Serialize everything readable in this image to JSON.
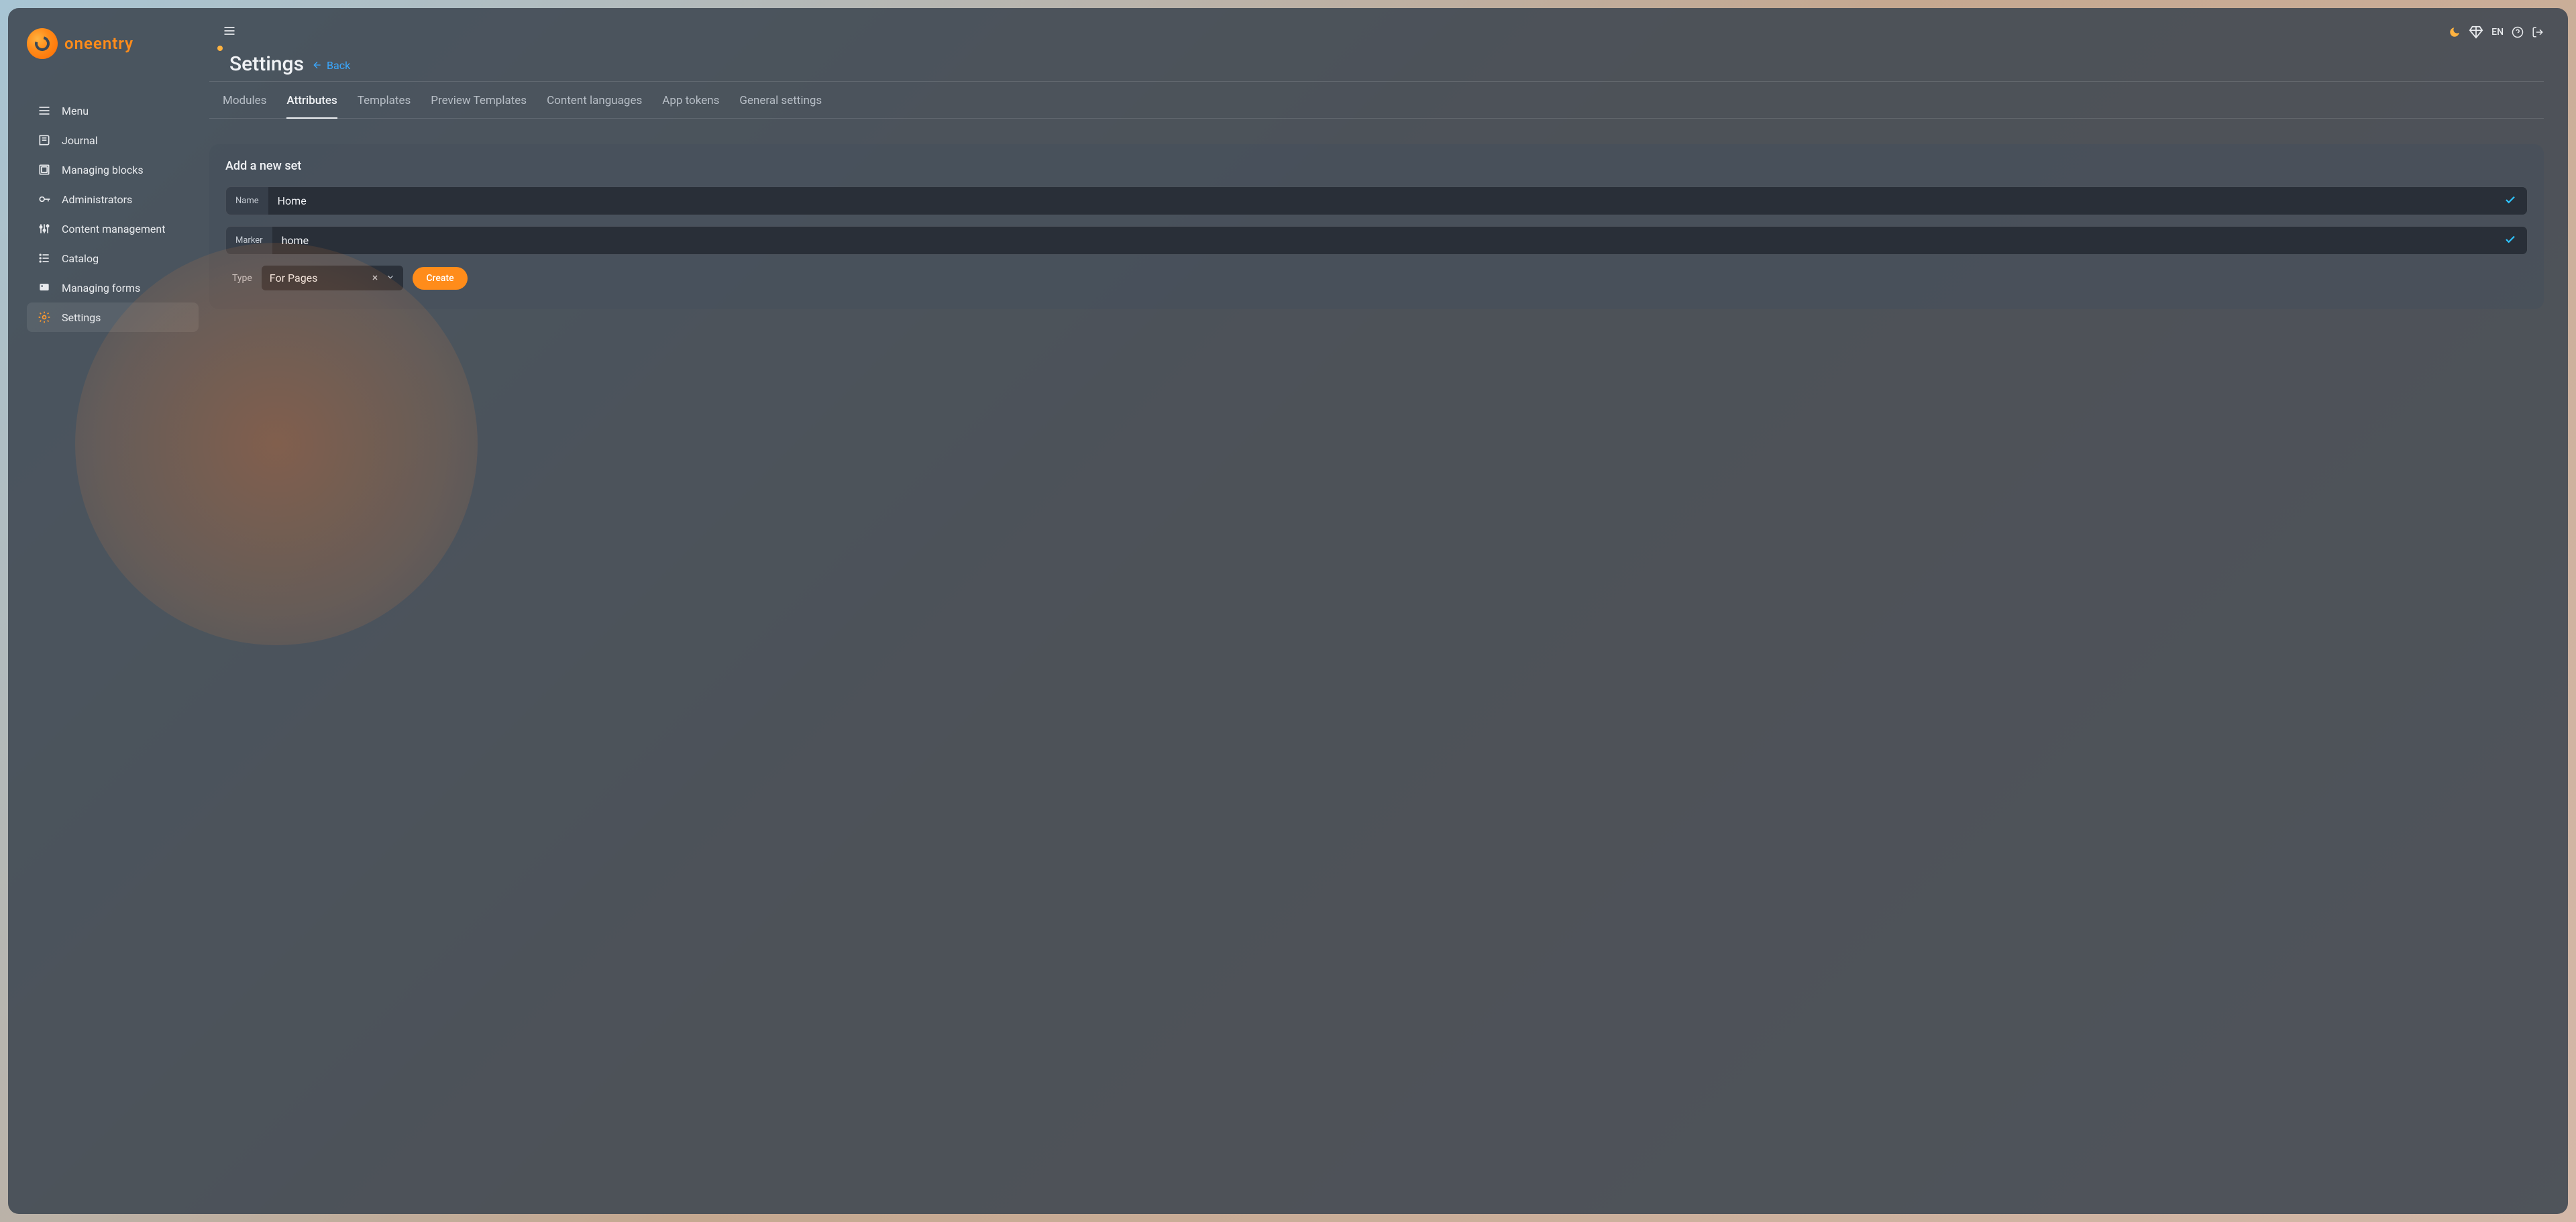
{
  "brand": {
    "name": "oneentry"
  },
  "topbar": {
    "language": "EN"
  },
  "sidebar": {
    "items": [
      {
        "label": "Menu"
      },
      {
        "label": "Journal"
      },
      {
        "label": "Managing blocks"
      },
      {
        "label": "Administrators"
      },
      {
        "label": "Content management"
      },
      {
        "label": "Catalog"
      },
      {
        "label": "Managing forms"
      },
      {
        "label": "Settings"
      }
    ]
  },
  "header": {
    "title": "Settings",
    "back_label": "Back"
  },
  "tabs": [
    {
      "label": "Modules"
    },
    {
      "label": "Attributes"
    },
    {
      "label": "Templates"
    },
    {
      "label": "Preview Templates"
    },
    {
      "label": "Content languages"
    },
    {
      "label": "App tokens"
    },
    {
      "label": "General settings"
    }
  ],
  "card": {
    "title": "Add a new set",
    "fields": {
      "name_label": "Name",
      "name_value": "Home",
      "marker_label": "Marker",
      "marker_value": "home",
      "type_label": "Type",
      "type_value": "For Pages"
    },
    "create_label": "Create"
  }
}
